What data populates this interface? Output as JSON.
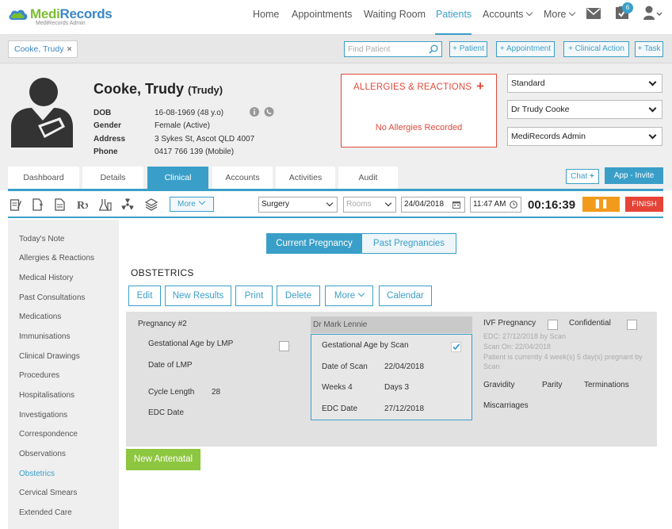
{
  "app": {
    "brand_part1": "Medi",
    "brand_part2": "Records",
    "subtitle": "MediRecords Admin",
    "colors": {
      "accent": "#3a9fc8",
      "brand_green": "#7cbd30",
      "brand_blue": "#3a87c8",
      "alert_red": "#e04a3a",
      "pause_orange": "#f29a1c",
      "finish_red": "#e54437",
      "action_green": "#8dc63f"
    }
  },
  "nav": {
    "items": [
      "Home",
      "Appointments",
      "Waiting Room",
      "Patients",
      "Accounts",
      "More"
    ],
    "active": "Patients",
    "tasks_badge": "6",
    "icons": [
      "mail-icon",
      "tasks-icon",
      "user-icon"
    ]
  },
  "patient_tab": {
    "label": "Cooke, Trudy",
    "close": "×"
  },
  "find": {
    "placeholder": "Find Patient"
  },
  "quick_buttons": {
    "patient": "+ Patient",
    "appointment": "+ Appointment",
    "clinical_action": "+ Clinical Action",
    "task": "+ Task"
  },
  "patient": {
    "name": "Cooke, Trudy",
    "nickname": "(Trudy)",
    "labels": {
      "dob": "DOB",
      "gender": "Gender",
      "address": "Address",
      "phone": "Phone"
    },
    "dob": "16-08-1969 (48 y.o)",
    "gender": "Female (Active)",
    "address": "3 Sykes St, Ascot QLD 4007",
    "phone": "0417 766 139 (Mobile)"
  },
  "allergies": {
    "title": "ALLERGIES & REACTIONS",
    "add": "+",
    "empty": "No Allergies Recorded"
  },
  "selects": {
    "billing": "Standard",
    "doctor": "Dr Trudy Cooke",
    "user": "MediRecords Admin"
  },
  "main_tabs": [
    "Dashboard",
    "Details",
    "Clinical",
    "Accounts",
    "Activities",
    "Audit"
  ],
  "main_tabs_active": "Clinical",
  "chat": {
    "label": "Chat",
    "plus": "+"
  },
  "app_invite": "App - Invite",
  "toolbar": {
    "icons": [
      "notes-icon",
      "document-edit-icon",
      "document-icon",
      "prescription-icon",
      "lab-icon",
      "radiation-icon",
      "stack-icon"
    ],
    "more": "More",
    "location": "Surgery",
    "rooms": "Rooms",
    "date": "24/04/2018",
    "time": "11:47 AM",
    "timer": "00:16:39",
    "pause": "❚❚",
    "finish": "FINISH"
  },
  "left_menu": {
    "items": [
      "Today's Note",
      "Allergies & Reactions",
      "Medical History",
      "Past Consultations",
      "Medications",
      "Immunisations",
      "Clinical Drawings",
      "Procedures",
      "Hospitalisations",
      "Investigations",
      "Correspondence",
      "Observations",
      "Obstetrics",
      "Cervical Smears",
      "Extended Care"
    ],
    "active": "Obstetrics"
  },
  "pregnancy_tabs": {
    "current": "Current Pregnancy",
    "past": "Past Pregnancies"
  },
  "section_title": "OBSTETRICS",
  "actions": {
    "edit": "Edit",
    "new_results": "New Results",
    "print": "Print",
    "delete": "Delete",
    "more": "More",
    "calendar": "Calendar"
  },
  "pregnancy": {
    "title": "Pregnancy #2",
    "ga_lmp_label": "Gestational Age by LMP",
    "date_lmp_label": "Date of LMP",
    "cycle_label": "Cycle Length",
    "cycle_value": "28",
    "edc_label": "EDC Date",
    "doctor": "Dr Mark Lennie",
    "scan": {
      "ga_scan_label": "Gestational Age by Scan",
      "ga_scan_checked": true,
      "date_of_scan_label": "Date of Scan",
      "date_of_scan": "22/04/2018",
      "weeks": "Weeks 4",
      "days": "Days 3",
      "edc_label": "EDC Date",
      "edc": "27/12/2018"
    },
    "ivf_label": "IVF Pregnancy",
    "confidential_label": "Confidential",
    "notes": [
      "EDC: 27/12/2018 by Scan",
      "Scan On: 22/04/2018",
      "Patient is currently 4 week(s) 5 day(s) pregnant by",
      "Scan"
    ],
    "gravidity": "Gravidity",
    "parity": "Parity",
    "terminations": "Terminations",
    "miscarriages": "Miscarriages"
  },
  "new_antenatal": "New Antenatal"
}
